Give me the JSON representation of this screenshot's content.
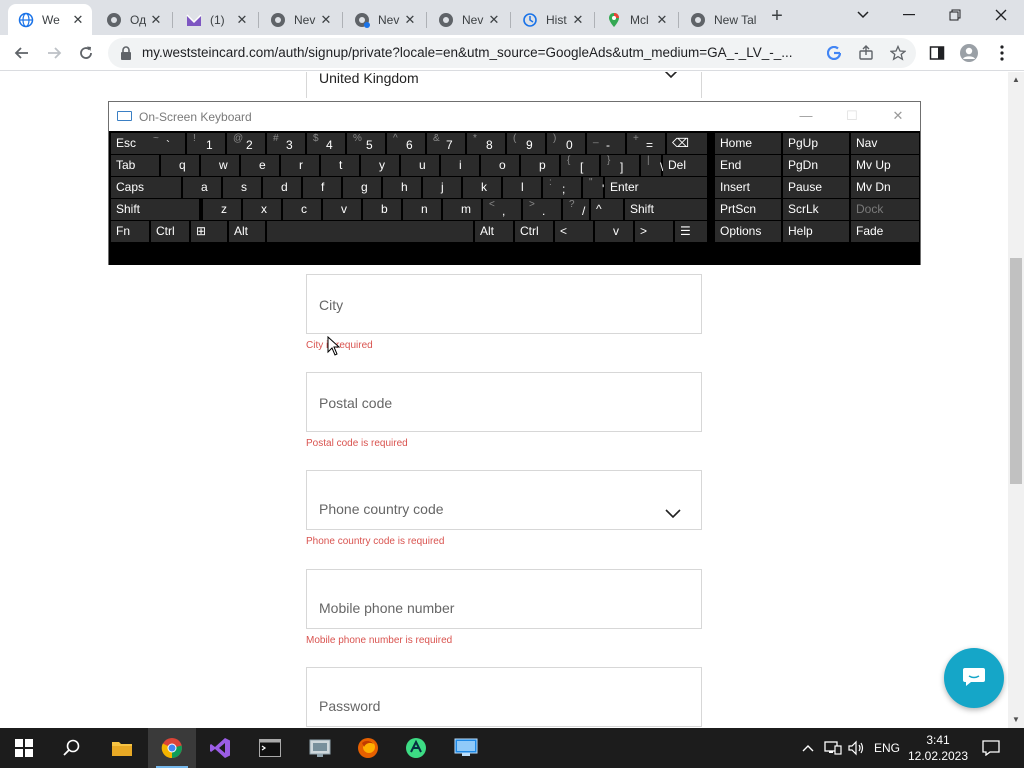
{
  "browser": {
    "tabs": [
      {
        "title": "We",
        "icon": "globe-icon",
        "active": true
      },
      {
        "title": "Од",
        "icon": "chrome-icon"
      },
      {
        "title": "(1) ",
        "icon": "mail-icon"
      },
      {
        "title": "Nev",
        "icon": "chrome-icon"
      },
      {
        "title": "Nev",
        "icon": "chrome-icon"
      },
      {
        "title": "Nev",
        "icon": "chrome-icon"
      },
      {
        "title": "Hist",
        "icon": "history-icon"
      },
      {
        "title": "Mcl",
        "icon": "maps-icon"
      },
      {
        "title": "New Tal",
        "icon": "chrome-icon"
      }
    ],
    "new_tab": "+",
    "url": "my.weststeincard.com/auth/signup/private?locale=en&utm_source=GoogleAds&utm_medium=GA_-_LV_-_..."
  },
  "form": {
    "country": "United Kingdom",
    "city_placeholder": "City",
    "city_error": "City is required",
    "postal_placeholder": "Postal code",
    "postal_error": "Postal code is required",
    "phone_code_placeholder": "Phone country code",
    "phone_code_error": "Phone country code is required",
    "mobile_placeholder": "Mobile phone number",
    "mobile_error": "Mobile phone number is required",
    "password_placeholder": "Password"
  },
  "osk": {
    "title": "On-Screen Keyboard",
    "rows": [
      [
        [
          "Esc",
          ""
        ],
        [
          "`",
          "~"
        ],
        [
          "1",
          "!"
        ],
        [
          "2",
          "@"
        ],
        [
          "3",
          "#"
        ],
        [
          "4",
          "$"
        ],
        [
          "5",
          "%"
        ],
        [
          "6",
          "^"
        ],
        [
          "7",
          "&"
        ],
        [
          "8",
          "*"
        ],
        [
          "9",
          "("
        ],
        [
          "0",
          ")"
        ],
        [
          "-",
          "_"
        ],
        [
          "=",
          "+"
        ],
        [
          "⌫",
          ""
        ]
      ],
      [
        [
          "Tab",
          ""
        ],
        [
          "q",
          ""
        ],
        [
          "w",
          ""
        ],
        [
          "e",
          ""
        ],
        [
          "r",
          ""
        ],
        [
          "t",
          ""
        ],
        [
          "y",
          ""
        ],
        [
          "u",
          ""
        ],
        [
          "i",
          ""
        ],
        [
          "o",
          ""
        ],
        [
          "p",
          ""
        ],
        [
          "[",
          "{"
        ],
        [
          "]",
          "}"
        ],
        [
          "\\",
          "|"
        ],
        [
          "Del",
          ""
        ]
      ],
      [
        [
          "Caps",
          ""
        ],
        [
          "a",
          ""
        ],
        [
          "s",
          ""
        ],
        [
          "d",
          ""
        ],
        [
          "f",
          ""
        ],
        [
          "g",
          ""
        ],
        [
          "h",
          ""
        ],
        [
          "j",
          ""
        ],
        [
          "k",
          ""
        ],
        [
          "l",
          ""
        ],
        [
          ";",
          ":"
        ],
        [
          "'",
          "\""
        ],
        [
          "Enter",
          ""
        ]
      ],
      [
        [
          "Shift",
          ""
        ],
        [
          "z",
          ""
        ],
        [
          "x",
          ""
        ],
        [
          "c",
          ""
        ],
        [
          "v",
          ""
        ],
        [
          "b",
          ""
        ],
        [
          "n",
          ""
        ],
        [
          "m",
          ""
        ],
        [
          ",",
          "<"
        ],
        [
          ".",
          ">"
        ],
        [
          "/",
          "?"
        ],
        [
          "^",
          ""
        ],
        [
          "Shift",
          ""
        ]
      ],
      [
        [
          "Fn",
          ""
        ],
        [
          "Ctrl",
          ""
        ],
        [
          "⊞",
          ""
        ],
        [
          "Alt",
          ""
        ],
        [
          "",
          ""
        ],
        [
          "Alt",
          ""
        ],
        [
          "Ctrl",
          ""
        ],
        [
          "<",
          ""
        ],
        [
          "v",
          ""
        ],
        [
          ">",
          ""
        ],
        [
          "☰",
          ""
        ]
      ]
    ],
    "right_keys": [
      [
        "Home",
        "PgUp",
        "Nav"
      ],
      [
        "End",
        "PgDn",
        "Mv Up"
      ],
      [
        "Insert",
        "Pause",
        "Mv Dn"
      ],
      [
        "PrtScn",
        "ScrLk",
        "Dock"
      ],
      [
        "Options",
        "Help",
        "Fade"
      ]
    ]
  },
  "taskbar": {
    "language": "ENG",
    "time": "3:41",
    "date": "12.02.2023"
  }
}
